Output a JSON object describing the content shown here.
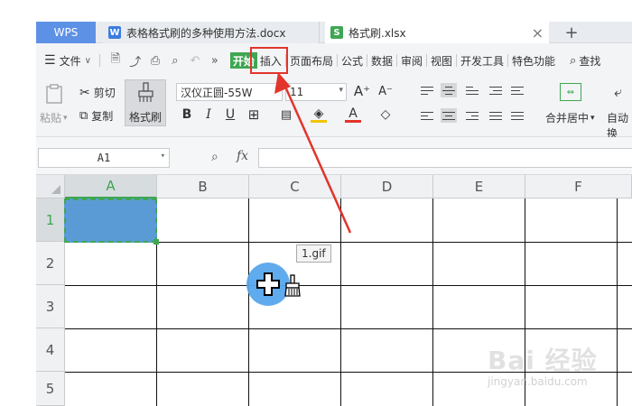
{
  "tabs": {
    "app": "WPS",
    "doc_label": "表格格式刷的多种使用方法.docx",
    "doc_icon_letter": "W",
    "xls_label": "格式刷.xlsx",
    "xls_icon_letter": "S",
    "close": "×",
    "new": "+"
  },
  "menu": {
    "file": "文件",
    "more": "»",
    "items": [
      "开始",
      "插入",
      "页面布局",
      "公式",
      "数据",
      "审阅",
      "视图",
      "开发工具",
      "特色功能"
    ],
    "search": "查找"
  },
  "ribbon": {
    "paste": "粘贴",
    "cut": "剪切",
    "copy": "复制",
    "format_painter": "格式刷",
    "font_name": "汉仪正圆-55W",
    "font_size": "11",
    "bold": "B",
    "italic": "I",
    "underline": "U",
    "merge_center": "合并居中",
    "auto_wrap": "自动换"
  },
  "formula_bar": {
    "cell_ref": "A1",
    "fx": "fx",
    "value": ""
  },
  "sheet": {
    "columns": [
      "A",
      "B",
      "C",
      "D",
      "E",
      "F"
    ],
    "rows": [
      "1",
      "2",
      "3",
      "4",
      "5"
    ],
    "selected_column": "A",
    "selected_row": "1"
  },
  "overlay": {
    "gif_label": "1.gif"
  },
  "watermark": {
    "brand": "Bai 经验",
    "url": "jingyan.baidu.com"
  },
  "colors": {
    "accent_green": "#3fa653",
    "wps_blue": "#5d91e6",
    "cell_fill": "#5b9bd5",
    "annotation_red": "#e2352c"
  }
}
